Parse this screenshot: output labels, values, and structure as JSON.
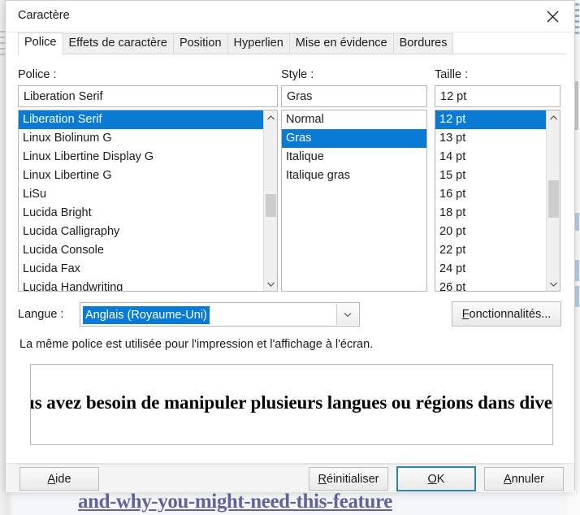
{
  "window": {
    "title": "Caractère",
    "close_icon": "close-x-icon"
  },
  "tabs": [
    {
      "label": "Police",
      "active": true
    },
    {
      "label": "Effets de caractère",
      "active": false
    },
    {
      "label": "Position",
      "active": false
    },
    {
      "label": "Hyperlien",
      "active": false
    },
    {
      "label": "Mise en évidence",
      "active": false
    },
    {
      "label": "Bordures",
      "active": false
    }
  ],
  "font": {
    "label": "Police :",
    "value": "Liberation Serif",
    "items": [
      "Liberation Serif",
      "Linux Biolinum G",
      "Linux Libertine Display G",
      "Linux Libertine G",
      "LiSu",
      "Lucida Bright",
      "Lucida Calligraphy",
      "Lucida Console",
      "Lucida Fax",
      "Lucida Handwriting"
    ],
    "selected_index": 0,
    "scroll_thumb_top_pct": 38,
    "scroll_thumb_height_pct": 12
  },
  "style": {
    "label": "Style :",
    "value": "Gras",
    "items": [
      "Normal",
      "Gras",
      "Italique",
      "Italique gras"
    ],
    "selected_index": 1
  },
  "size": {
    "label": "Taille :",
    "value": "12 pt",
    "items": [
      "12 pt",
      "13 pt",
      "14 pt",
      "15 pt",
      "16 pt",
      "18 pt",
      "20 pt",
      "22 pt",
      "24 pt",
      "26 pt"
    ],
    "selected_index": 0,
    "scroll_thumb_top_pct": 33,
    "scroll_thumb_height_pct": 20
  },
  "language": {
    "label": "Langue :",
    "value": "Anglais (Royaume-Uni)",
    "dropdown_icon": "chevron-down-icon"
  },
  "features_button": {
    "label": "Fonctionnalités...",
    "accel": "F"
  },
  "note": "La même police est utilisée pour l'impression et l'affichage à l'écran.",
  "preview": {
    "text": "us avez besoin de manipuler plusieurs langues ou régions dans divers pa"
  },
  "buttons": {
    "help": {
      "label": "Aide",
      "accel": "A"
    },
    "reset": {
      "label": "Réinitialiser",
      "accel": "R"
    },
    "ok": {
      "label": "OK",
      "accel": "O",
      "focused": true
    },
    "cancel": {
      "label": "Annuler",
      "accel": "A"
    }
  },
  "background": {
    "link_text": "and-why-you-might-need-this-feature"
  },
  "colors": {
    "selection_blue": "#0a7bd4",
    "focus_border": "#2e86ab",
    "dialog_bg": "#ffffff",
    "button_bar_bg": "#f4f4f4",
    "link_color": "#2b2b7a"
  }
}
